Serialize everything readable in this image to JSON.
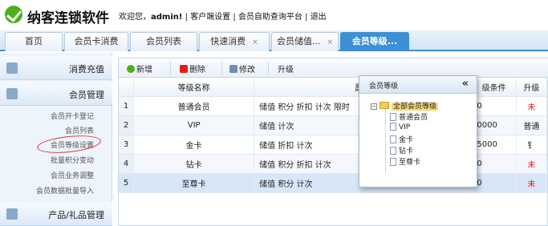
{
  "header": {
    "app_title": "纳客连锁软件",
    "welcome_prefix": "欢迎您，",
    "username": "admin!",
    "links": [
      "客户端设置",
      "会员自助查询平台",
      "退出"
    ],
    "separator": "|"
  },
  "tabs": [
    {
      "label": "首页",
      "closable": false
    },
    {
      "label": "会员卡消费",
      "closable": false
    },
    {
      "label": "会员列表",
      "closable": false
    },
    {
      "label": "快速消费",
      "closable": true
    },
    {
      "label": "会员储值...",
      "closable": true
    },
    {
      "label": "会员等级...",
      "closable": false,
      "active": true
    }
  ],
  "tab_close_glyph": "×",
  "sidebar": {
    "sections": [
      {
        "label": "消费充值",
        "icon": "user-icon"
      },
      {
        "label": "会员管理",
        "icon": "card-icon"
      },
      {
        "label": "产品/礼品管理",
        "icon": "gift-icon"
      }
    ],
    "items": [
      "会员开卡登记",
      "会员列表",
      "会员等级设置",
      "批量积分变动",
      "会员业务调整",
      "会员数据批量导入"
    ]
  },
  "toolbar": {
    "add_label": "新增",
    "delete_label": "删除",
    "edit_label": "修改",
    "upgrade_label": "升级"
  },
  "table": {
    "headers": {
      "name": "等级名称",
      "attr": "属性",
      "cond": "级条件",
      "up": "升级"
    },
    "rows": [
      {
        "num": "1",
        "name": "普通会员",
        "attr": "储值 积分 折扣 计次 限时",
        "cond": "0",
        "up": "未"
      },
      {
        "num": "2",
        "name": "VIP",
        "attr": "储值 计次",
        "cond": "0000",
        "up": "普通"
      },
      {
        "num": "3",
        "name": "金卡",
        "attr": "储值 折扣 计次",
        "cond": "5000",
        "up": "钅"
      },
      {
        "num": "4",
        "name": "钻卡",
        "attr": "储值 积分 折扣 计次",
        "cond": "0",
        "up": "未"
      },
      {
        "num": "5",
        "name": "至尊卡",
        "attr": "储值 积分 计次",
        "cond": "0",
        "up": "未"
      }
    ]
  },
  "popup": {
    "title": "会员等级",
    "close_glyph": "«",
    "root_expander": "−",
    "root_label": "全部会员等级",
    "nodes": [
      "普通会员",
      "VIP",
      "金卡",
      "钻卡",
      "至尊卡"
    ]
  },
  "colors": {
    "accent": "#3d8fd6",
    "logo": "#4caf1e",
    "annotation_circle": "#d93232",
    "upgrade_text": "#e0201b"
  }
}
